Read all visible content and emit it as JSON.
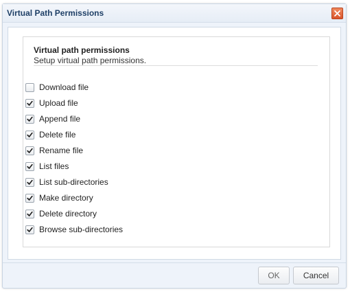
{
  "dialog": {
    "title": "Virtual Path Permissions",
    "close_icon": "close-icon"
  },
  "section": {
    "title": "Virtual path permissions",
    "subtitle": "Setup virtual path permissions."
  },
  "permissions": [
    {
      "label": "Download file",
      "checked": false
    },
    {
      "label": "Upload file",
      "checked": true
    },
    {
      "label": "Append file",
      "checked": true
    },
    {
      "label": "Delete file",
      "checked": true
    },
    {
      "label": "Rename file",
      "checked": true
    },
    {
      "label": "List files",
      "checked": true
    },
    {
      "label": "List sub-directories",
      "checked": true
    },
    {
      "label": "Make directory",
      "checked": true
    },
    {
      "label": "Delete directory",
      "checked": true
    },
    {
      "label": "Browse sub-directories",
      "checked": true
    }
  ],
  "buttons": {
    "ok_label": "OK",
    "cancel_label": "Cancel"
  },
  "colors": {
    "title_text": "#1e3f66",
    "close_button": "#d9542b",
    "dialog_background": "#eef3fa"
  }
}
